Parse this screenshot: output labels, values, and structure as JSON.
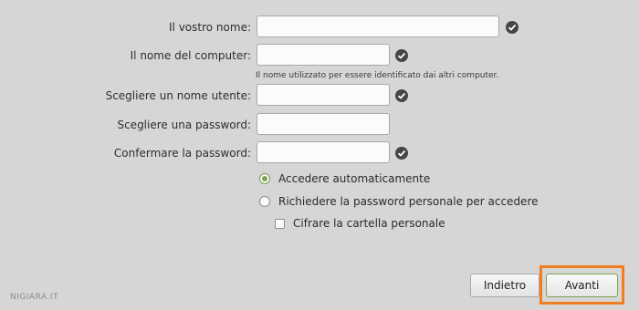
{
  "form": {
    "name": {
      "label": "Il vostro nome:",
      "value": "",
      "valid": true
    },
    "computer": {
      "label": "Il nome del computer:",
      "value": "",
      "valid": true,
      "hint": "Il nome utilizzato per essere identificato dai altri computer."
    },
    "username": {
      "label": "Scegliere un nome utente:",
      "value": "",
      "valid": true
    },
    "password": {
      "label": "Scegliere una password:",
      "value": "",
      "valid": false
    },
    "confirm": {
      "label": "Confermare la password:",
      "value": "",
      "valid": true
    }
  },
  "login_options": {
    "auto": {
      "label": "Accedere automaticamente",
      "selected": true
    },
    "require_password": {
      "label": "Richiedere la password personale per accedere",
      "selected": false
    },
    "encrypt_home": {
      "label": "Cifrare la cartella personale",
      "checked": false
    }
  },
  "buttons": {
    "back_label": "Indietro",
    "next_label": "Avanti"
  },
  "highlight_color": "#f07d1f",
  "accent_color": "#7fa352",
  "icons": {
    "valid": "check-circle-icon"
  },
  "watermark": "NIGIARA.IT"
}
